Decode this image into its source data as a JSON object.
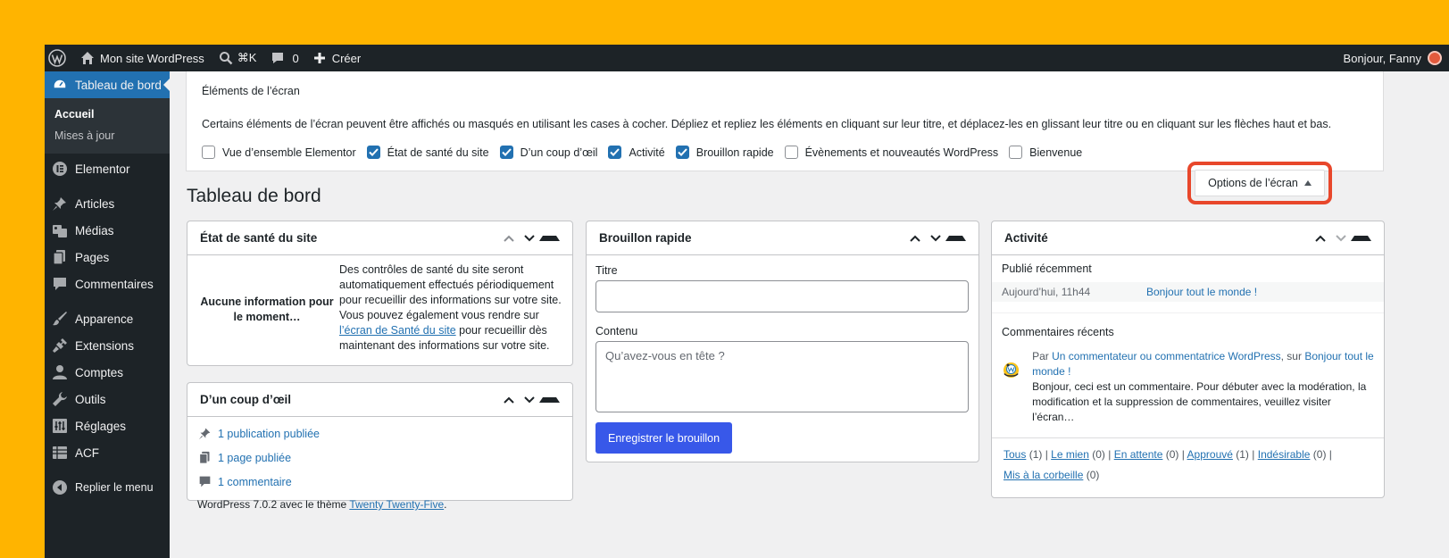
{
  "admin_bar": {
    "site_name": "Mon site WordPress",
    "search_shortcut": "⌘K",
    "comments_count": "0",
    "create_label": "Créer",
    "greeting": "Bonjour, Fanny"
  },
  "sidebar": {
    "current": "Tableau de bord",
    "submenu": [
      "Accueil",
      "Mises à jour"
    ],
    "items": [
      "Elementor",
      "Articles",
      "Médias",
      "Pages",
      "Commentaires",
      "Apparence",
      "Extensions",
      "Comptes",
      "Outils",
      "Réglages",
      "ACF",
      "Replier le menu"
    ]
  },
  "screen_options": {
    "title": "Éléments de l’écran",
    "description": "Certains éléments de l’écran peuvent être affichés ou masqués en utilisant les cases à cocher. Dépliez et repliez les éléments en cliquant sur leur titre, et déplacez-les en glissant leur titre ou en cliquant sur les flèches haut et bas.",
    "checkboxes": [
      {
        "label": "Vue d’ensemble Elementor",
        "checked": false
      },
      {
        "label": "État de santé du site",
        "checked": true
      },
      {
        "label": "D’un coup d’œil",
        "checked": true
      },
      {
        "label": "Activité",
        "checked": true
      },
      {
        "label": "Brouillon rapide",
        "checked": true
      },
      {
        "label": "Évènements et nouveautés WordPress",
        "checked": false
      },
      {
        "label": "Bienvenue",
        "checked": false
      }
    ],
    "button_label": "Options de l’écran",
    "highlight_color": "#e8472b"
  },
  "page_title": "Tableau de bord",
  "health": {
    "title": "État de santé du site",
    "status": "Aucune information pour le moment…",
    "text_before": "Des contrôles de santé du site seront automatiquement effectués périodiquement pour recueillir des informations sur votre site. Vous pouvez également vous rendre sur ",
    "link": "l’écran de Santé du site",
    "text_after": " pour recueillir dès maintenant des informations sur votre site."
  },
  "glance": {
    "title": "D’un coup d’œil",
    "posts": "1 publication publiée",
    "pages": "1 page publiée",
    "comments": "1 commentaire",
    "footer_before": "WordPress 7.0.2 avec le thème ",
    "theme": "Twenty Twenty-Five",
    "footer_after": "."
  },
  "quick_draft": {
    "title": "Brouillon rapide",
    "title_label": "Titre",
    "title_value": "",
    "content_label": "Contenu",
    "content_placeholder": "Qu’avez-vous en tête ?",
    "button": "Enregistrer le brouillon"
  },
  "activity": {
    "title": "Activité",
    "recent_published": "Publié récemment",
    "post_date": "Aujourd’hui, 11h44",
    "post_title": "Bonjour tout le monde !",
    "recent_comments": "Commentaires récents",
    "comment_by_prefix": "Par ",
    "comment_author": "Un commentateur ou commentatrice WordPress",
    "comment_on": ", sur ",
    "comment_post": "Bonjour tout le monde !",
    "comment_excerpt": "Bonjour, ceci est un commentaire. Pour débuter avec la modération, la modification et la suppression de commentaires, veuillez visiter l’écran…",
    "filters": [
      {
        "label": "Tous",
        "count": "(1)"
      },
      {
        "label": "Le mien",
        "count": "(0)"
      },
      {
        "label": "En attente",
        "count": "(0)"
      },
      {
        "label": "Approuvé",
        "count": "(1)"
      },
      {
        "label": "Indésirable",
        "count": "(0)"
      },
      {
        "label": "Mis à la corbeille",
        "count": "(0)"
      }
    ]
  },
  "colors": {
    "background": "#ffb400",
    "admin_dark": "#1d2327",
    "accent": "#2271b1",
    "button": "#3858e9"
  }
}
